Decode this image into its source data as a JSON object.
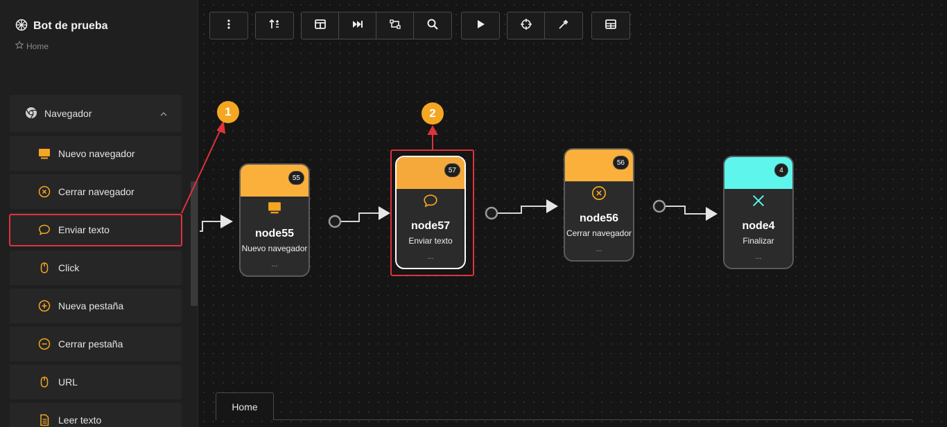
{
  "app": {
    "title": "Bot de prueba",
    "breadcrumb": "Home"
  },
  "sidebar": {
    "group": {
      "label": "Navegador",
      "icon": "chrome-icon"
    },
    "items": [
      {
        "label": "Nuevo navegador",
        "icon": "monitor-icon"
      },
      {
        "label": "Cerrar navegador",
        "icon": "close-circle-icon"
      },
      {
        "label": "Enviar texto",
        "icon": "message-icon"
      },
      {
        "label": "Click",
        "icon": "mouse-icon"
      },
      {
        "label": "Nueva pestaña",
        "icon": "plus-circle-icon"
      },
      {
        "label": "Cerrar pestaña",
        "icon": "minus-circle-icon"
      },
      {
        "label": "URL",
        "icon": "mouse-icon"
      },
      {
        "label": "Leer texto",
        "icon": "document-icon"
      }
    ]
  },
  "toolbar": {
    "buttons": [
      "more-vert-icon",
      "sort-icon",
      "layout-icon",
      "skip-forward-icon",
      "select-area-icon",
      "search-icon",
      "play-icon",
      "crosshair-icon",
      "eyedropper-icon",
      "table-icon"
    ]
  },
  "nodes": [
    {
      "id": "55",
      "name": "node55",
      "desc": "Nuevo navegador",
      "dots": "...",
      "color": "#fbb03b",
      "icon": "monitor-icon"
    },
    {
      "id": "57",
      "name": "node57",
      "desc": "Enviar texto",
      "dots": "...",
      "color": "#f6a93b",
      "icon": "message-icon"
    },
    {
      "id": "56",
      "name": "node56",
      "desc": "Cerrar navegador",
      "dots": "...",
      "color": "#fbb03b",
      "icon": "close-circle-icon"
    },
    {
      "id": "4",
      "name": "node4",
      "desc": "Finalizar",
      "dots": "...",
      "color": "#5df5ec",
      "icon": "x-icon"
    }
  ],
  "annotations": {
    "marker1": "1",
    "marker2": "2"
  },
  "tabs": [
    {
      "label": "Home"
    }
  ],
  "colors": {
    "accent": "#f5a623",
    "highlight": "#e0323b",
    "end_node": "#5df5ec"
  }
}
